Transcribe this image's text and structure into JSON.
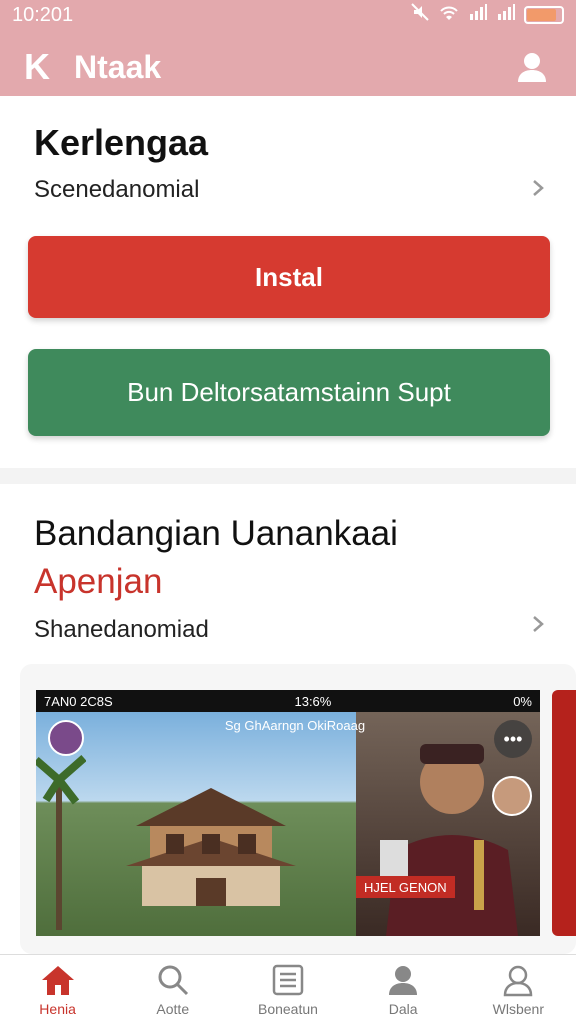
{
  "status_bar": {
    "time": "10:201"
  },
  "app_bar": {
    "logo": "K",
    "title": "Ntaak"
  },
  "section1": {
    "title": "Kerlengaa",
    "subtitle": "Scenedanomial",
    "install_label": "Instal",
    "support_label": "Bun Deltorsatamstainn Supt"
  },
  "section2": {
    "title": "Bandangian Uanankaai",
    "title_accent": "Apenjan",
    "subtitle": "Shanedanomiad",
    "media": {
      "status_left": "7AN0  2C8S",
      "status_mid": "13:6%",
      "status_right": "0%",
      "caption": "Sg GhAarngn OkiRoaag",
      "live_label": "HJEL GENON"
    }
  },
  "bottom_nav": {
    "items": [
      {
        "label": "Henia",
        "icon": "home-icon",
        "active": true
      },
      {
        "label": "Aotte",
        "icon": "search-icon",
        "active": false
      },
      {
        "label": "Boneatun",
        "icon": "list-icon",
        "active": false
      },
      {
        "label": "Dala",
        "icon": "person-icon",
        "active": false
      },
      {
        "label": "Wlsbenr",
        "icon": "user-outline-icon",
        "active": false
      }
    ]
  },
  "colors": {
    "header": "#e3a9ad",
    "install": "#d63a30",
    "support": "#3f8a5c",
    "accent": "#c8342c"
  }
}
